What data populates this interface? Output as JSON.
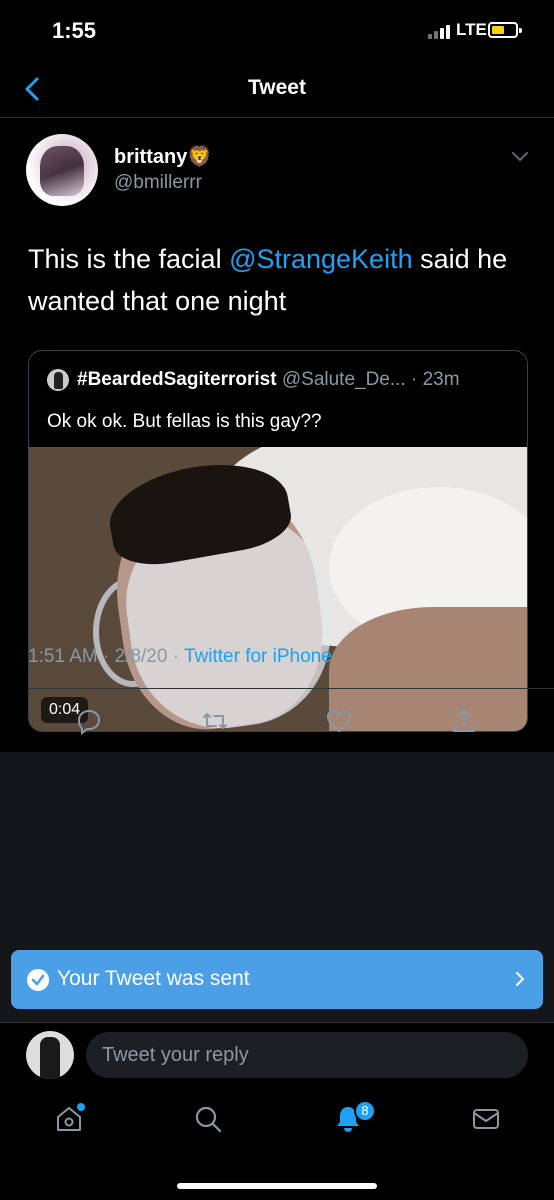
{
  "status": {
    "time": "1:55",
    "network": "LTE",
    "battery_color": "#fbd200"
  },
  "nav": {
    "title": "Tweet"
  },
  "tweet": {
    "name": "brittany🦁",
    "handle": "@bmillerrr",
    "text_before": "This is the facial ",
    "mention": "@StrangeKeith",
    "text_after": " said he wanted that one night",
    "timestamp": "1:51 AM · 2/8/20 · ",
    "source": "Twitter for iPhone"
  },
  "quote": {
    "name": "#BeardedSagiterrorist",
    "meta": " @Salute_De... · 23m",
    "text": "Ok ok ok. But fellas is this gay??",
    "duration": "0:04"
  },
  "actions": [
    "reply-icon",
    "retweet-icon",
    "like-icon",
    "share-icon"
  ],
  "toast": {
    "text": "Your Tweet was sent"
  },
  "reply": {
    "placeholder": "Tweet your reply"
  },
  "tabbar": {
    "notification_count": "8"
  },
  "colors": {
    "accent": "#1da1f2",
    "toast": "#4a9fe6",
    "muted": "#8899a6"
  }
}
